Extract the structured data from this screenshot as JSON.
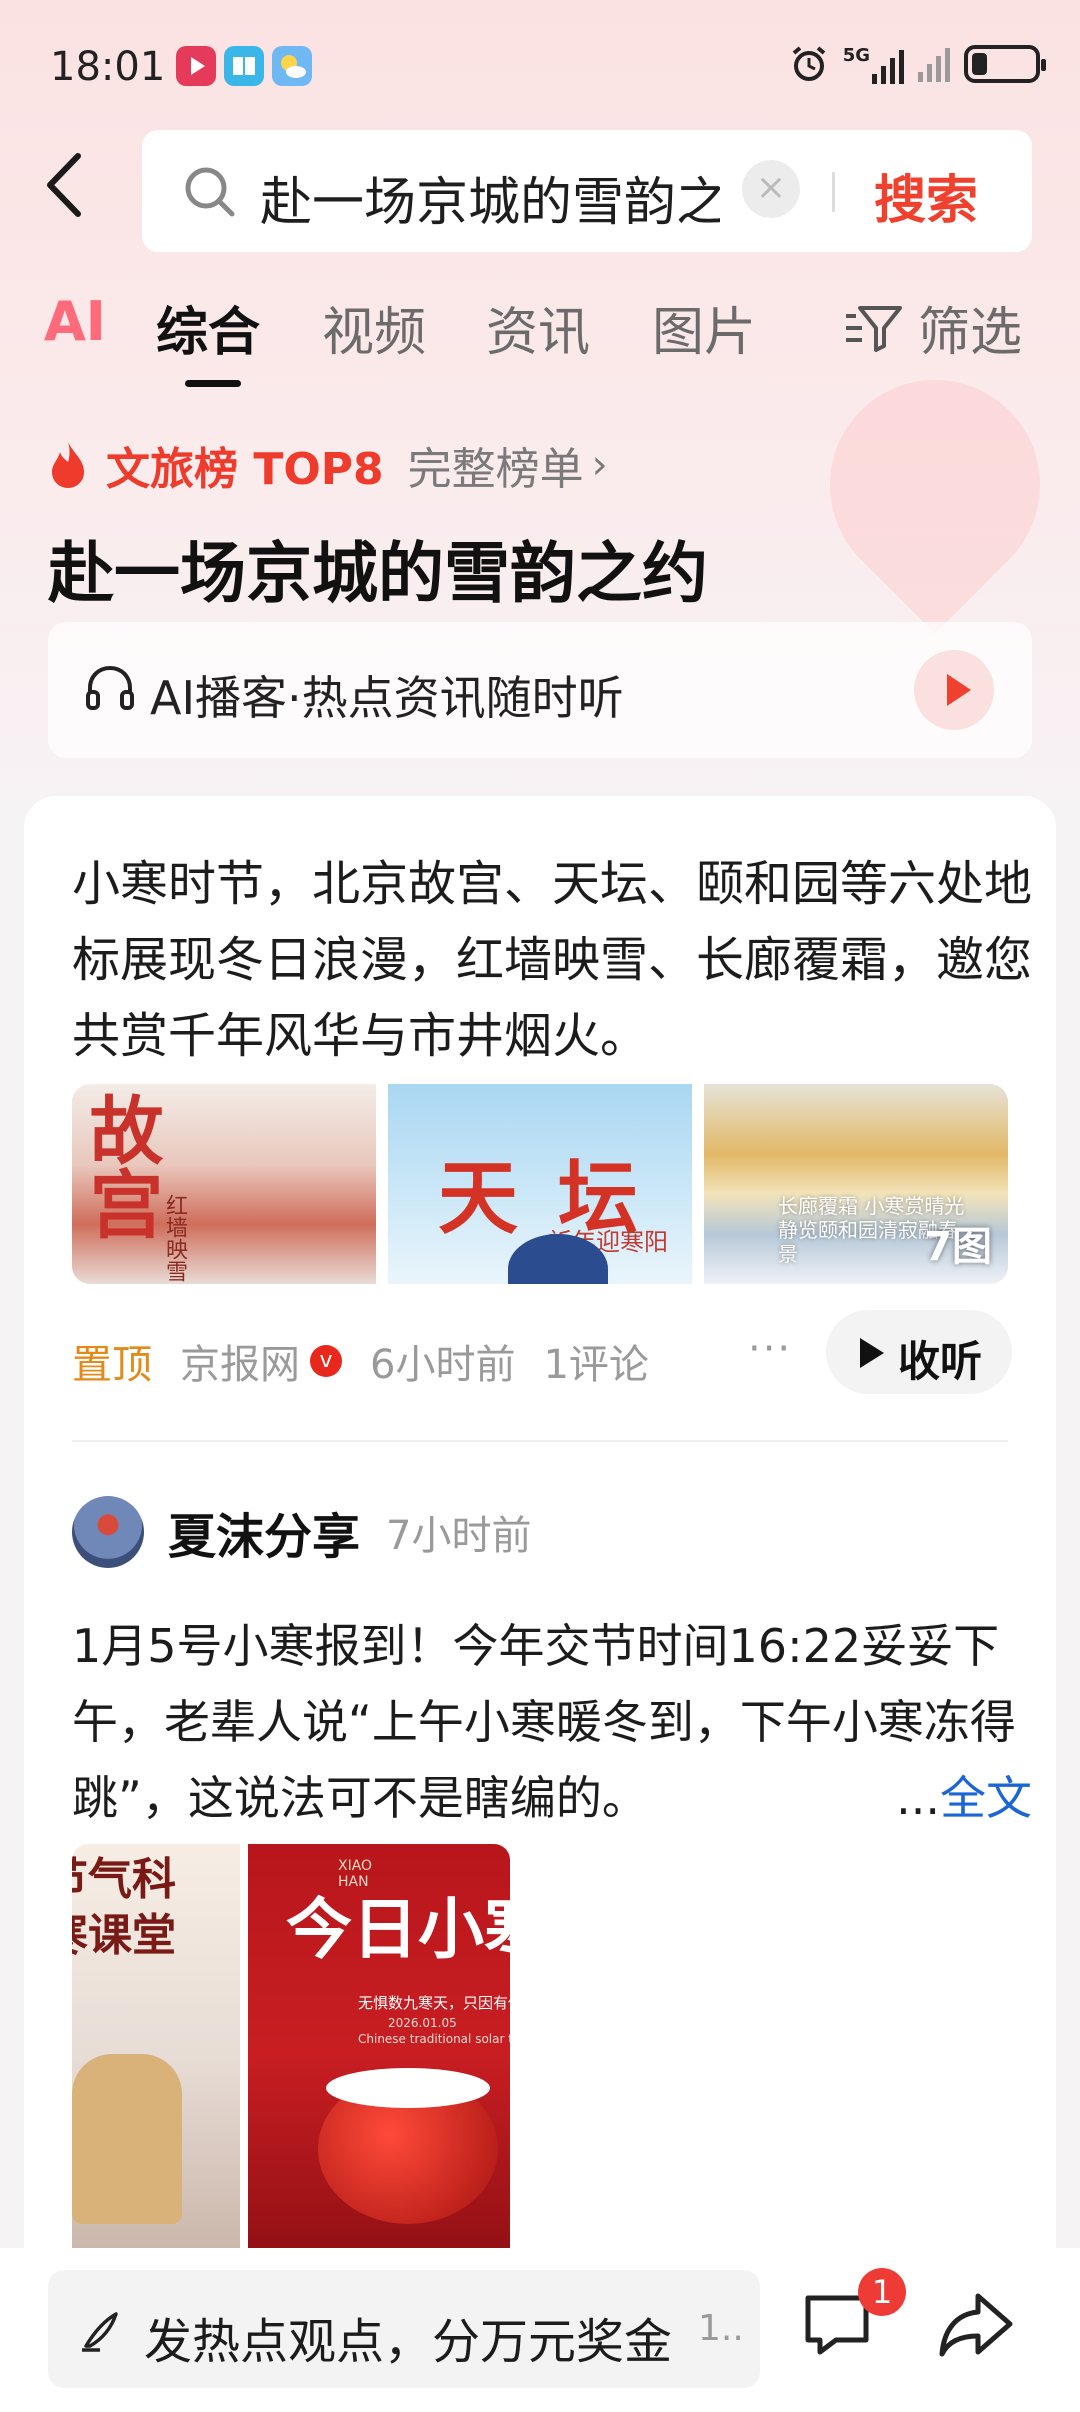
{
  "status_bar": {
    "time": "18:01",
    "network": "5G",
    "battery_level": 0.25
  },
  "search": {
    "query": "赴一场京城的雪韵之约",
    "clear_icon": "×",
    "button_label": "搜索"
  },
  "tabs": [
    {
      "label": "AI"
    },
    {
      "label": "综合"
    },
    {
      "label": "视频"
    },
    {
      "label": "资讯"
    },
    {
      "label": "图片"
    }
  ],
  "filter_label": "筛选",
  "ranking": {
    "label": "文旅榜 TOP8",
    "link": "完整榜单",
    "chevron": "›"
  },
  "topic_title": "赴一场京城的雪韵之约",
  "podcast": {
    "text": "AI播客·热点资讯随时听"
  },
  "article": {
    "summary": "小寒时节，北京故宫、天坛、颐和园等六处地标展现冬日浪漫，红墙映雪、长廊覆霜，邀您共赏千年风华与市井烟火。",
    "images": [
      {
        "big": "故宫",
        "small": "红墙映雪"
      },
      {
        "big": "天坛",
        "small": "祈年迎寒阳"
      },
      {
        "small": "长廊覆霜 小寒赏晴光 静览颐和园清寂融春景",
        "count": "7图"
      }
    ],
    "pin": "置顶",
    "source": "京报网",
    "verified_mark": "v",
    "time": "6小时前",
    "comments": "1评论",
    "more": "···",
    "listen_label": "收听"
  },
  "post": {
    "author": "夏沫分享",
    "time": "7小时前",
    "text": "1月5号小寒报到！今年交节时间16:22妥妥下午，老辈人说“上午小寒暖冬到，下午小寒冻得跳”，这说法可不是瞎编的。",
    "more_dots": "...",
    "full_text_link": "全文",
    "images": [
      {
        "title": "节气科\n寒课堂"
      },
      {
        "tiny": "XIAO\nHAN",
        "title": "今日小寒",
        "sub": "无惧数九寒天，只因有你陪伴",
        "sub2": "2026.01.05",
        "sub3": "Chinese traditional solar term"
      }
    ]
  },
  "bottom_bar": {
    "comment_placeholder": "发热点观点，分万元奖金",
    "comment_more": "1..",
    "badge_count": "1"
  },
  "colors": {
    "accent": "#f0402e",
    "link": "#1a66d6",
    "pin": "#e48a1a"
  }
}
